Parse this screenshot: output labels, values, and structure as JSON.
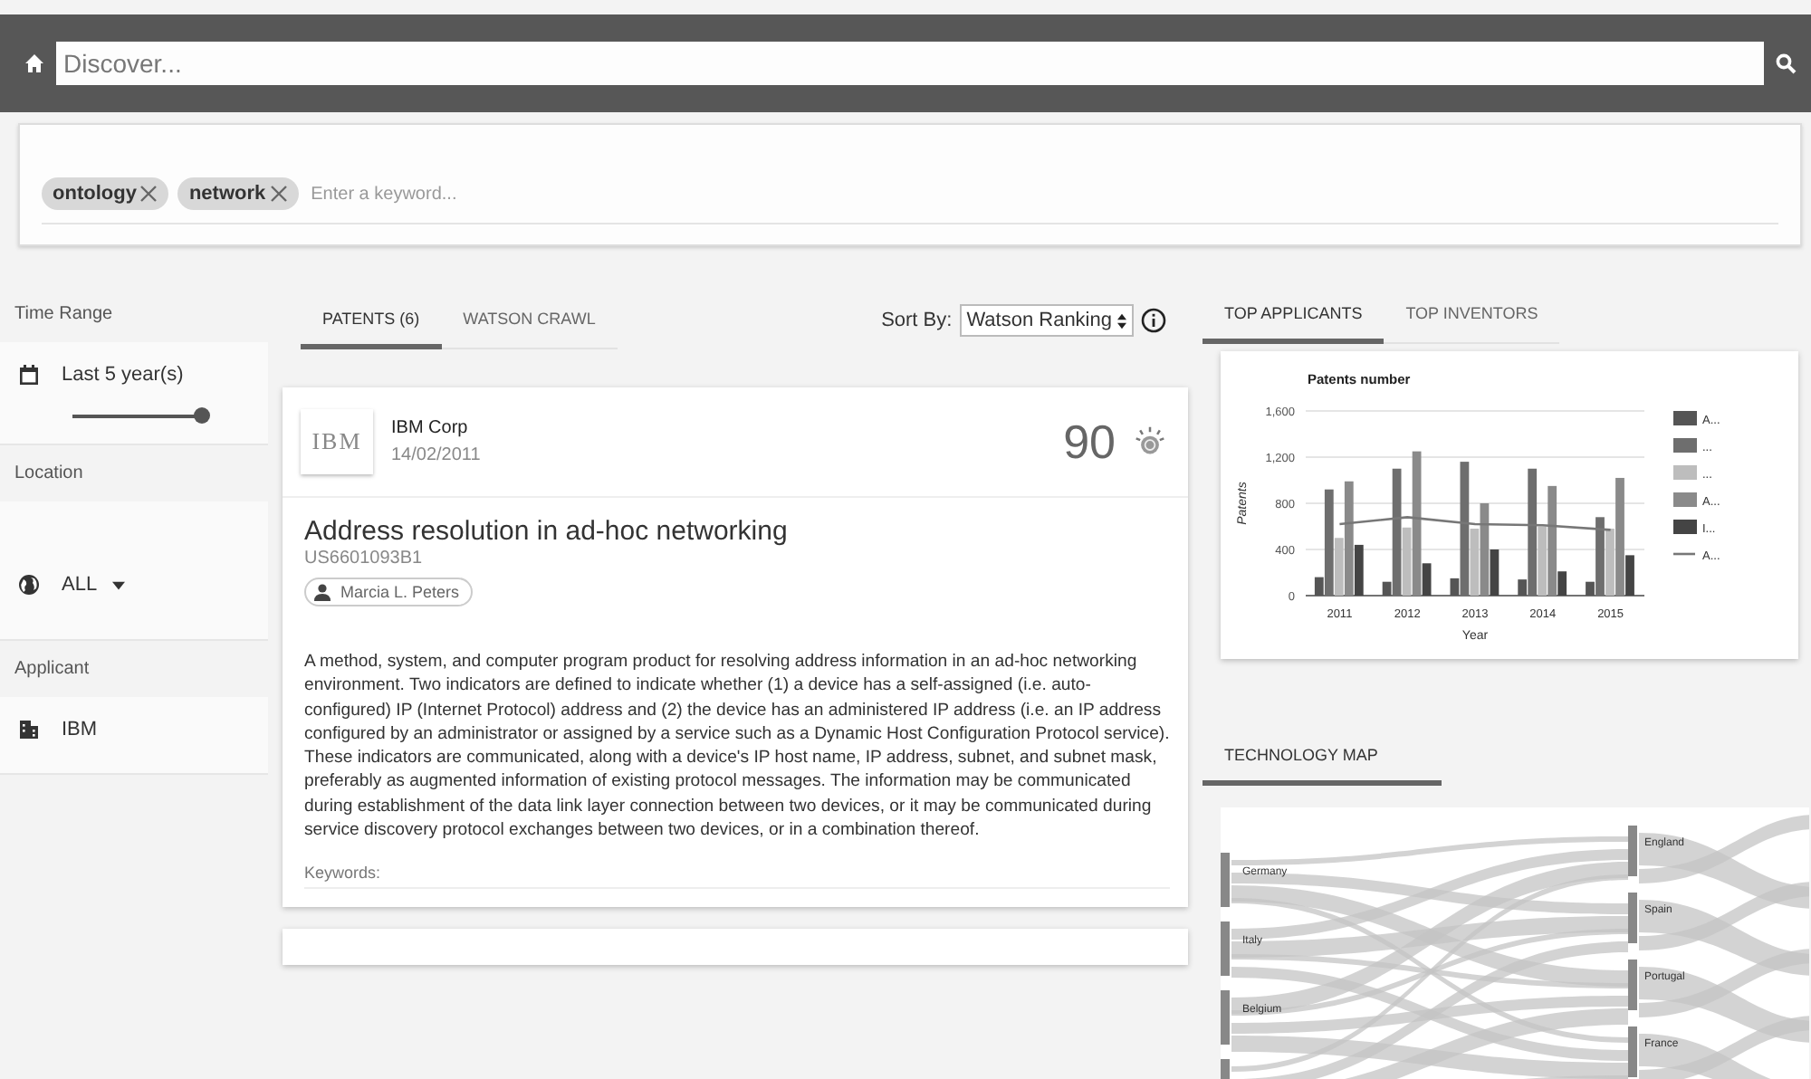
{
  "search": {
    "placeholder": "Discover..."
  },
  "keywords": {
    "chips": [
      {
        "label": "ontology"
      },
      {
        "label": "network"
      }
    ],
    "placeholder": "Enter a keyword..."
  },
  "filters": [
    {
      "kind": "time",
      "heading": "Time Range",
      "value": "Last 5 year(s)",
      "level": 1
    },
    {
      "kind": "location",
      "heading": "Location",
      "value": "ALL"
    },
    {
      "kind": "applicant",
      "heading": "Applicant",
      "value": "IBM"
    }
  ],
  "results": {
    "tabs": [
      {
        "label": "PATENTS (6)",
        "selected": true
      },
      {
        "label": "WATSON CRAWL",
        "selected": false
      }
    ],
    "sort_label": "Sort By:",
    "sort_value": "Watson Ranking",
    "patents": [
      {
        "logo_text": "IBM",
        "company": "IBM Corp",
        "date": "14/02/2011",
        "score": "90",
        "title": "Address resolution in ad-hoc networking",
        "number": "US6601093B1",
        "inventor": "Marcia L. Peters",
        "abstract": "A method, system, and computer program product for resolving address information in an ad-hoc networking environment. Two indicators are defined to indicate whether (1) a device has a self-assigned (i.e. auto-configured) IP (Internet Protocol) address and (2) the device has an administered IP address (i.e. an IP address configured by an administrator or assigned by a service such as a Dynamic Host Configuration Protocol service). These indicators are communicated, along with a device's IP host name, IP address, subnet, and subnet mask, preferably as augmented information of existing protocol messages. The information may be communicated during establishment of the data link layer connection between two devices, or it may be communicated during service discovery protocol exchanges between two devices, or in a combination thereof.",
        "keywords_label": "Keywords:"
      }
    ]
  },
  "insights": {
    "tabs": [
      {
        "label": "TOP APPLICANTS",
        "selected": true
      },
      {
        "label": "TOP INVENTORS",
        "selected": false
      }
    ],
    "chart_data": {
      "type": "bar",
      "stacked": false,
      "grid": true,
      "legend": "right",
      "title": "Patents number",
      "xlabel": "Year",
      "ylabel": "Patents",
      "categories": [
        "2011",
        "2012",
        "2013",
        "2014",
        "2015"
      ],
      "ylim": [
        0,
        1600
      ],
      "yticks": [
        {
          "value": 0,
          "label": "0"
        },
        {
          "value": 400,
          "label": "400"
        },
        {
          "value": 800,
          "label": "800"
        },
        {
          "value": 1200,
          "label": "1,200"
        },
        {
          "value": 1600,
          "label": "1,600"
        }
      ],
      "series": [
        {
          "name": "A...",
          "color": "#555555",
          "values": [
            160,
            120,
            150,
            140,
            120
          ]
        },
        {
          "name": "...",
          "color": "#6e6e6e",
          "values": [
            920,
            1100,
            1160,
            1100,
            680
          ]
        },
        {
          "name": "...",
          "color": "#bdbdbd",
          "values": [
            500,
            590,
            580,
            600,
            580
          ]
        },
        {
          "name": "A...",
          "color": "#8a8a8a",
          "values": [
            990,
            1250,
            800,
            950,
            1020
          ]
        },
        {
          "name": "I...",
          "color": "#444444",
          "values": [
            440,
            280,
            400,
            210,
            350
          ]
        },
        {
          "name": "A...",
          "color": "#777777",
          "type": "line",
          "values": [
            620,
            680,
            620,
            610,
            570
          ]
        }
      ]
    }
  },
  "technology_map": {
    "tab": {
      "label": "TECHNOLOGY MAP",
      "selected": true
    },
    "sources": [
      "Germany",
      "Italy",
      "Belgium"
    ],
    "targets": [
      "England",
      "Spain",
      "Portugal",
      "France"
    ]
  }
}
